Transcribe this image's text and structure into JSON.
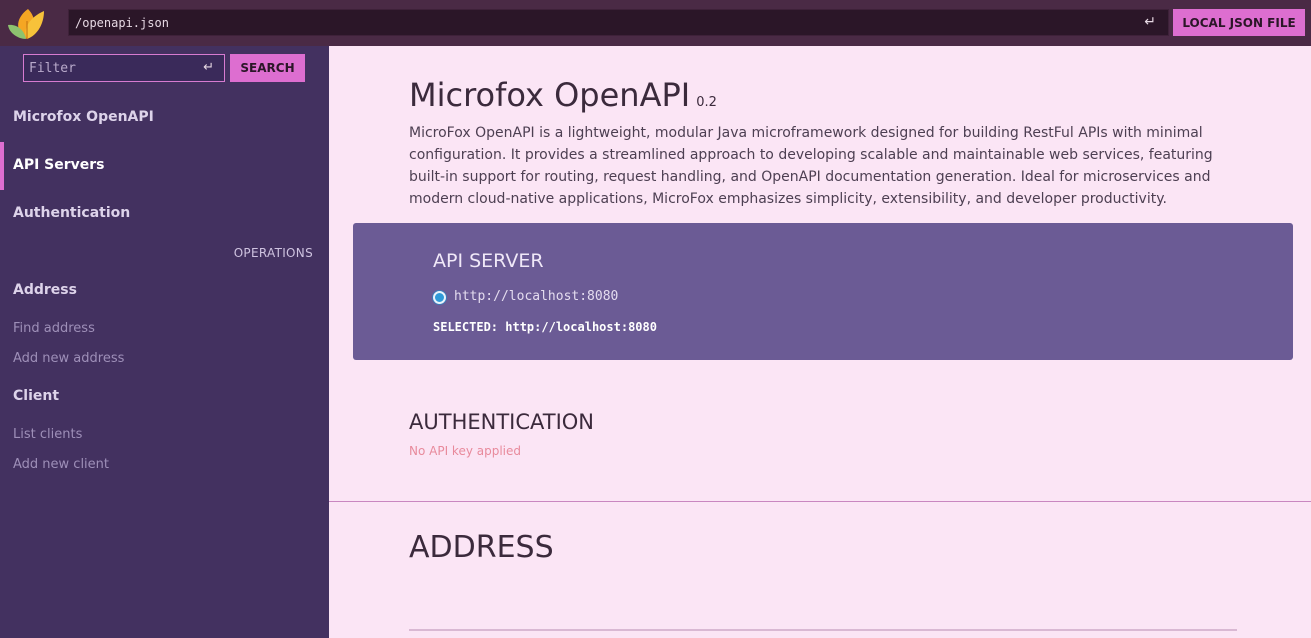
{
  "header": {
    "spec_url": "/openapi.json",
    "enter_glyph": "↵",
    "local_json_button": "LOCAL JSON FILE",
    "logo_icon": "leaf-logo-icon"
  },
  "sidebar": {
    "filter_placeholder": "Filter",
    "enter_glyph": "↵",
    "search_button": "SEARCH",
    "items": [
      {
        "label": "Microfox OpenAPI"
      },
      {
        "label": "API Servers"
      },
      {
        "label": "Authentication"
      }
    ],
    "operations_label": "OPERATIONS",
    "tags": [
      {
        "label": "Address",
        "operations": [
          {
            "label": "Find address"
          },
          {
            "label": "Add new address"
          }
        ]
      },
      {
        "label": "Client",
        "operations": [
          {
            "label": "List clients"
          },
          {
            "label": "Add new client"
          }
        ]
      }
    ],
    "accent_color": "#dd6ed0"
  },
  "main": {
    "title": "Microfox OpenAPI",
    "version": "0.2",
    "description": "MicroFox OpenAPI is a lightweight, modular Java microframework designed for building RestFul APIs with minimal configuration. It provides a streamlined approach to developing scalable and maintainable web services, featuring built-in support for routing, request handling, and OpenAPI documentation generation. Ideal for microservices and modern cloud-native applications, MicroFox emphasizes simplicity, extensibility, and developer productivity.",
    "server_panel": {
      "title": "API SERVER",
      "server_url": "http://localhost:8080",
      "selected_text": "SELECTED: http://localhost:8080"
    },
    "authentication": {
      "title": "AUTHENTICATION",
      "status": "No API key applied"
    },
    "section_title": "ADDRESS"
  },
  "colors": {
    "topbar": "#4a2a45",
    "sidebar": "#433160",
    "main_bg": "#fbe5f5",
    "server_panel": "#6b5b95",
    "button": "#dd6ed0"
  }
}
